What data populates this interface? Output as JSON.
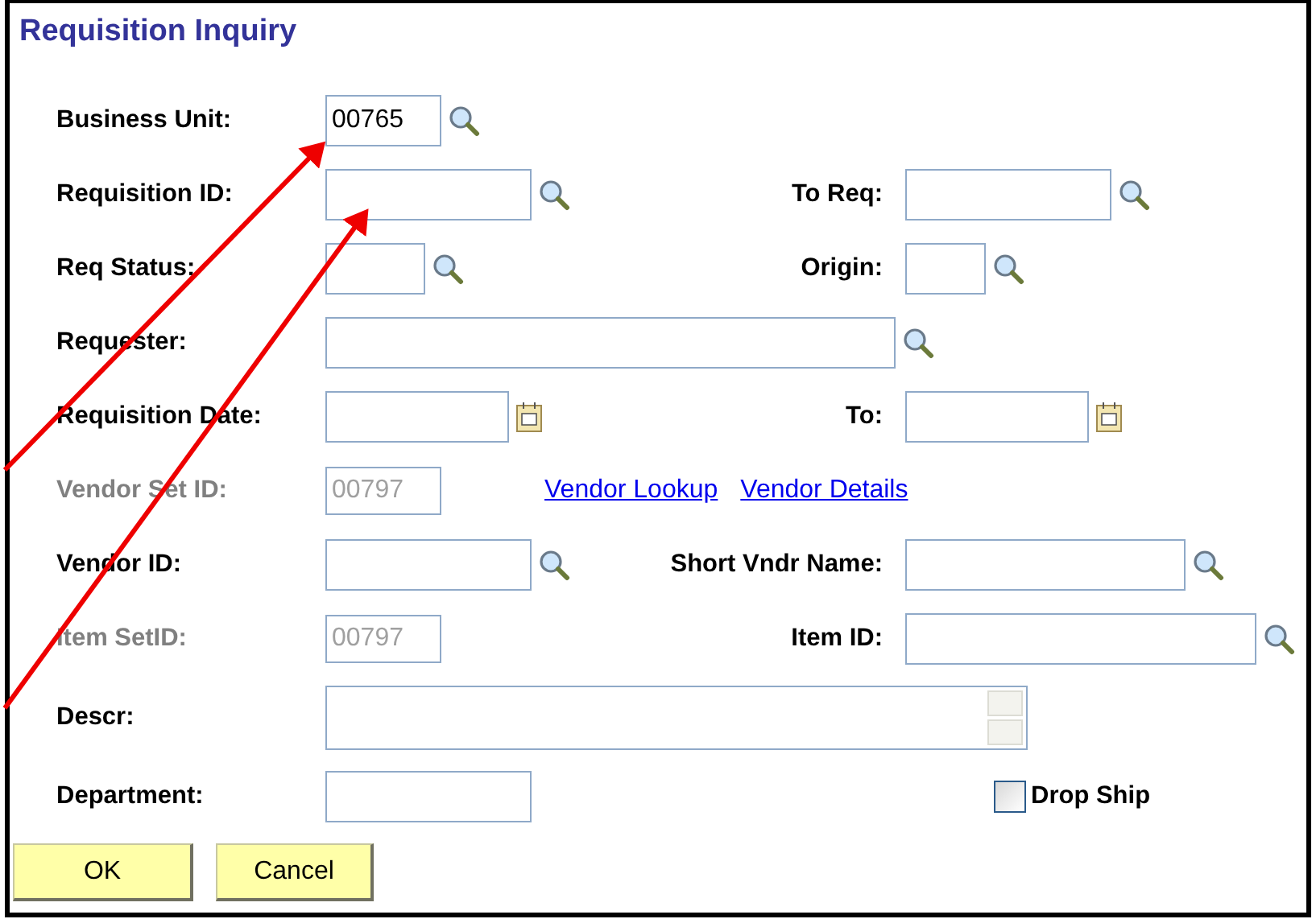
{
  "title": "Requisition Inquiry",
  "rows": [
    {
      "fields": [
        {
          "label": "Business Unit:",
          "value": "00765",
          "kind": "lookup",
          "disabled": false
        }
      ]
    },
    {
      "fields": [
        {
          "label": "Requisition ID:",
          "kind": "lookup",
          "disabled": false
        },
        {
          "label": "To Req:",
          "kind": "lookup",
          "disabled": false
        }
      ]
    },
    {
      "fields": [
        {
          "label": "Req Status:",
          "kind": "lookup",
          "disabled": false
        },
        {
          "label": "Origin:",
          "kind": "lookup",
          "disabled": false
        }
      ]
    },
    {
      "fields": [
        {
          "label": "Requester:",
          "kind": "lookup",
          "disabled": false
        }
      ]
    },
    {
      "fields": [
        {
          "label": "Requisition Date:",
          "kind": "date",
          "disabled": false
        },
        {
          "label": "To:",
          "kind": "date",
          "disabled": false
        }
      ]
    },
    {
      "fields": [
        {
          "label": "Vendor Set ID:",
          "value": "00797",
          "kind": "text",
          "disabled": true
        }
      ],
      "links": [
        "Vendor Lookup",
        "Vendor Details"
      ]
    },
    {
      "fields": [
        {
          "label": "Vendor ID:",
          "kind": "lookup",
          "disabled": false
        },
        {
          "label": "Short Vndr Name:",
          "kind": "lookup",
          "disabled": false
        }
      ]
    },
    {
      "fields": [
        {
          "label": "Item SetID:",
          "value": "00797",
          "kind": "text",
          "disabled": true
        },
        {
          "label": "Item ID:",
          "kind": "lookup",
          "disabled": false
        }
      ]
    },
    {
      "fields": [
        {
          "label": "Descr:",
          "kind": "textarea",
          "disabled": false
        }
      ]
    },
    {
      "fields": [
        {
          "label": "Department:",
          "kind": "text",
          "disabled": false
        }
      ],
      "checkbox": {
        "label": "Drop Ship",
        "checked": false
      }
    }
  ],
  "buttons": [
    "OK",
    "Cancel"
  ]
}
